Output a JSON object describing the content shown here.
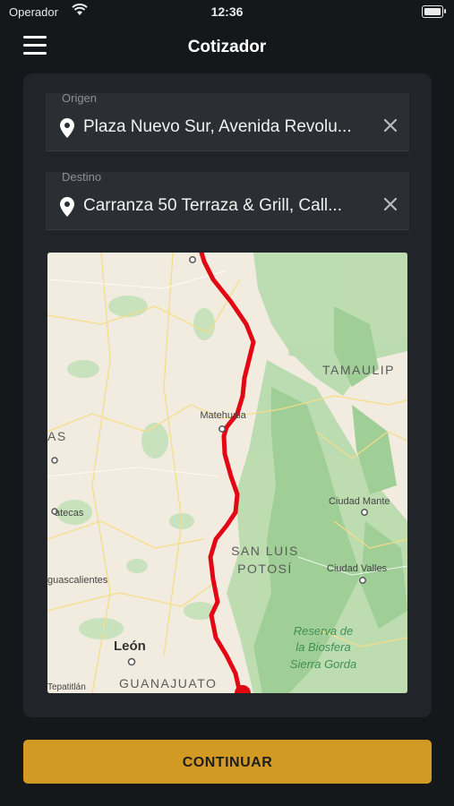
{
  "status_bar": {
    "carrier": "Operador",
    "time": "12:36"
  },
  "nav": {
    "title": "Cotizador"
  },
  "origin": {
    "label": "Origen",
    "value": "Plaza Nuevo Sur, Avenida Revolu..."
  },
  "destination": {
    "label": "Destino",
    "value": "Carranza 50 Terraza & Grill, Call..."
  },
  "map": {
    "labels": {
      "tamaulipas": "TAMAULIP",
      "matehuala": "Matehuala",
      "as": "AS",
      "zacatecas": "atecas",
      "ciudad_mante": "Ciudad Mante",
      "san_luis_1": "SAN LUIS",
      "san_luis_2": "POTOSÍ",
      "ciudad_valles": "Ciudad Valles",
      "aguascalientes": "guascalientes",
      "reserva_1": "Reserva de",
      "reserva_2": "la Biosfera",
      "reserva_3": "Sierra Gorda",
      "leon": "León",
      "guanajuato": "GUANAJUATO",
      "tepatitlan": "Tepatitlán"
    }
  },
  "cta": {
    "label": "CONTINUAR"
  },
  "colors": {
    "accent": "#d39a23",
    "route": "#e30613",
    "background": "#15181b",
    "card": "#212529"
  },
  "icons": [
    "wifi-icon",
    "battery-icon",
    "menu-icon",
    "location-pin-icon",
    "close-icon"
  ]
}
